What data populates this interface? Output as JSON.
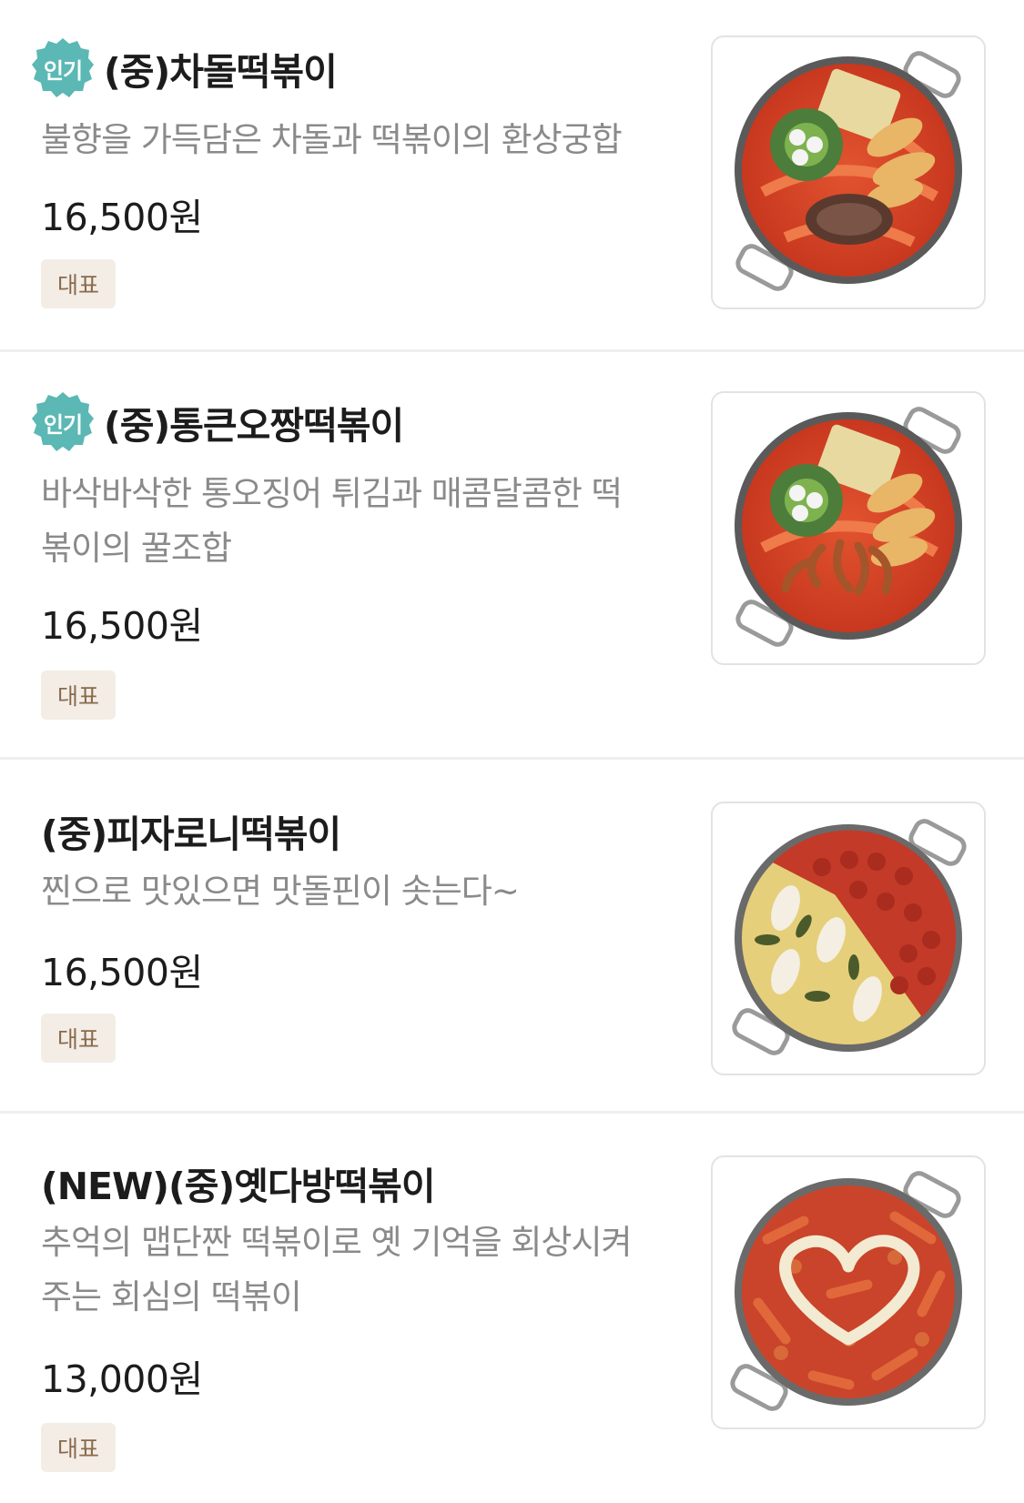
{
  "menu_items": [
    {
      "popular_badge": "인기",
      "name": "(중)차돌떡볶이",
      "description": [
        "불향을 가득담은 차돌과 떡볶이의 환상궁합"
      ],
      "price": "16,500원",
      "tag": "대표",
      "image_icon": "chadol-tteokbokki-photo"
    },
    {
      "popular_badge": "인기",
      "name": "(중)통큰오짱떡볶이",
      "description": [
        "바삭바삭한 통오징어 튀김과 매콤달콤한 떡",
        "볶이의 꿀조합"
      ],
      "price": "16,500원",
      "tag": "대표",
      "image_icon": "squid-tteokbokki-photo"
    },
    {
      "name": "(중)피자로니떡볶이",
      "description": [
        "찐으로 맛있으면 맛돌핀이 솟는다~"
      ],
      "price": "16,500원",
      "tag": "대표",
      "image_icon": "pizza-pepperoni-tteokbokki-photo"
    },
    {
      "name": "(NEW)(중)옛다방떡볶이",
      "description": [
        "추억의 맵단짠 떡볶이로 옛 기억을 회상시켜",
        "주는 회심의 떡볶이"
      ],
      "price": "13,000원",
      "tag": "대표",
      "image_icon": "heart-mayo-tteokbokki-photo"
    }
  ],
  "colors": {
    "popular_badge": "#5bb8b4",
    "tag_bg": "#f3ede6",
    "tag_text": "#8a6a4c",
    "sauce": "#d8462a"
  }
}
